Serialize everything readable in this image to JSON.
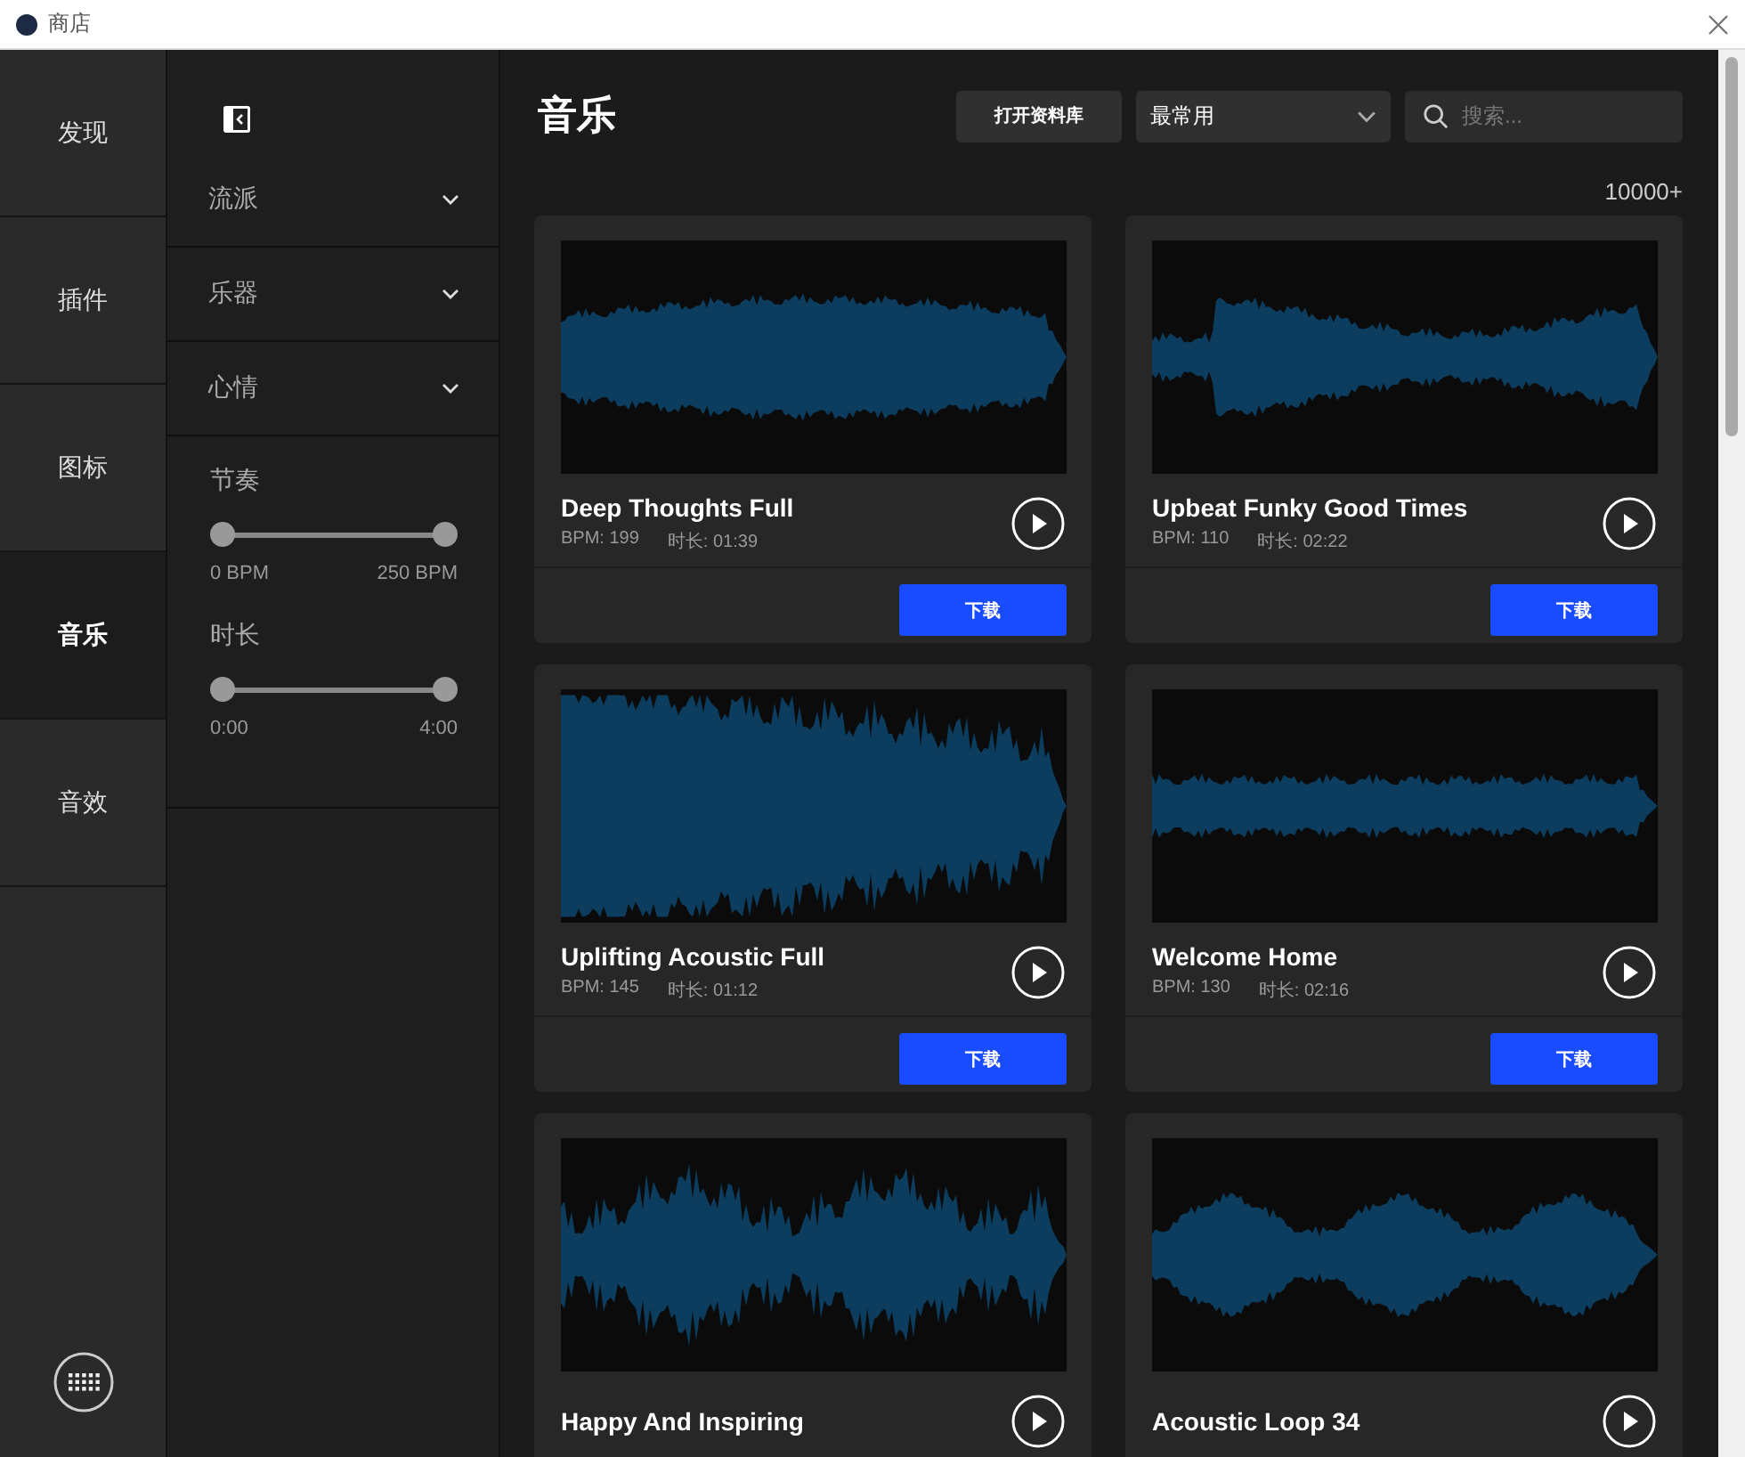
{
  "window": {
    "title": "商店"
  },
  "nav": [
    {
      "label": "发现",
      "selected": false
    },
    {
      "label": "插件",
      "selected": false
    },
    {
      "label": "图标",
      "selected": false
    },
    {
      "label": "音乐",
      "selected": true
    },
    {
      "label": "音效",
      "selected": false
    }
  ],
  "filters": {
    "groups": [
      {
        "label": "流派",
        "expanded": false
      },
      {
        "label": "乐器",
        "expanded": false
      },
      {
        "label": "心情",
        "expanded": false
      }
    ],
    "ranges": [
      {
        "label": "节奏",
        "min_label": "0 BPM",
        "max_label": "250 BPM",
        "thumbs": [
          {
            "level": 0
          },
          {
            "level": 1
          }
        ]
      },
      {
        "label": "时长",
        "min_label": "0:00",
        "max_label": "4:00",
        "thumbs": [
          {
            "level": 0
          },
          {
            "level": 1
          }
        ]
      }
    ]
  },
  "header": {
    "title": "音乐",
    "library_button": "打开资料库",
    "sort": "最常用",
    "search": {
      "placeholder": "搜索..."
    },
    "count": "10000+"
  },
  "tracks": [
    {
      "title": "Deep Thoughts Full",
      "bpm": "BPM: 199",
      "duration": "时长: 01:39",
      "download": "下载"
    },
    {
      "title": "Upbeat Funky Good Times",
      "bpm": "BPM: 110",
      "duration": "时长: 02:22",
      "download": "下载"
    },
    {
      "title": "Uplifting Acoustic Full",
      "bpm": "BPM: 145",
      "duration": "时长: 01:12",
      "download": "下载"
    },
    {
      "title": "Welcome Home",
      "bpm": "BPM: 130",
      "duration": "时长: 02:16",
      "download": "下载"
    },
    {
      "title": "Happy And Inspiring"
    },
    {
      "title": "Acoustic Loop 34"
    }
  ]
}
